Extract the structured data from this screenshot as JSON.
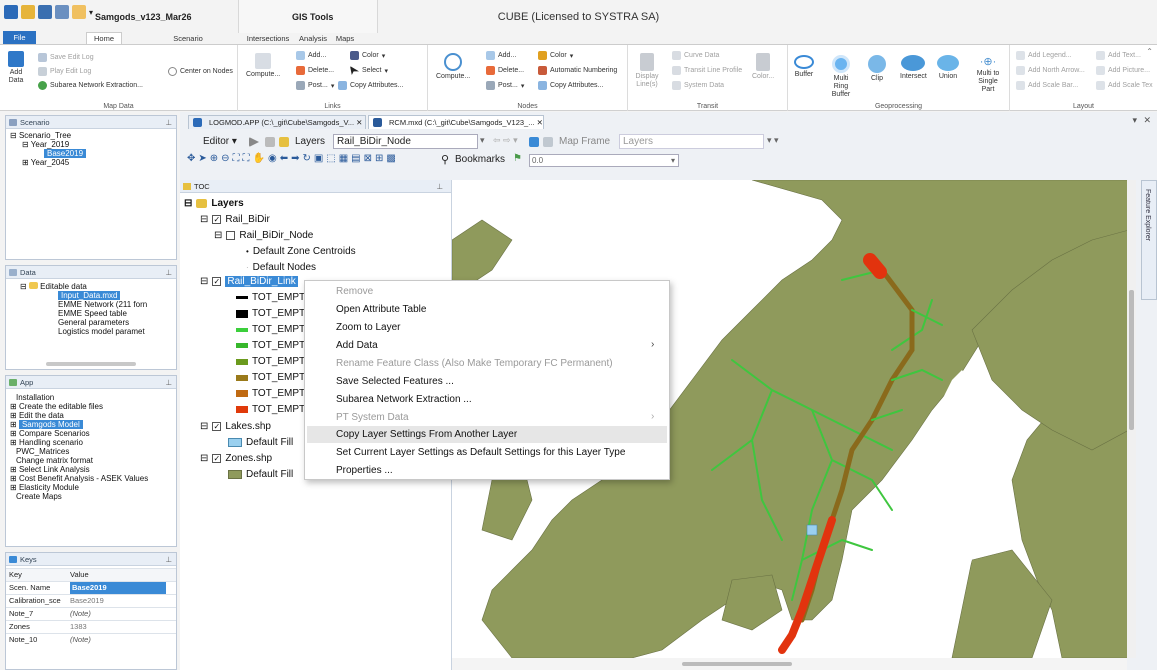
{
  "window": {
    "app_title": "CUBE (Licensed to SYSTRA SA)",
    "doc_title": "Samgods_v123_Mar26",
    "context_title": "GIS Tools"
  },
  "tabs": {
    "file": "File",
    "home": "Home",
    "scenario": "Scenario",
    "intersections": "Intersections",
    "analysis": "Analysis",
    "maps": "Maps"
  },
  "ribbon": {
    "map_data": {
      "label": "Map Data",
      "add_data": "Add Data",
      "save_edit_log": "Save Edit Log",
      "play_edit_log": "Play Edit Log",
      "subarea_extraction": "Subarea Network Extraction...",
      "center_on_nodes": "Center on Nodes"
    },
    "links": {
      "label": "Links",
      "compute": "Compute...",
      "add": "Add...",
      "delete": "Delete...",
      "post": "Post...",
      "color": "Color",
      "select": "Select",
      "copy_attributes": "Copy Attributes..."
    },
    "nodes": {
      "label": "Nodes",
      "compute": "Compute...",
      "add": "Add...",
      "delete": "Delete...",
      "post": "Post...",
      "color": "Color",
      "automatic_numbering": "Automatic Numbering",
      "copy_attributes": "Copy Attributes..."
    },
    "transit": {
      "label": "Transit",
      "display_lines": "Display Line(s)",
      "curve_data": "Curve Data",
      "transit_line_profile": "Transit Line Profile",
      "system_data": "System Data",
      "color": "Color..."
    },
    "geoprocessing": {
      "label": "Geoprocessing",
      "buffer": "Buffer",
      "multi_ring_buffer": "Multi Ring Buffer",
      "clip": "Clip",
      "intersect": "Intersect",
      "union": "Union",
      "multi_to_single": "Multi to Single Part"
    },
    "layout": {
      "label": "Layout",
      "add_legend": "Add Legend...",
      "add_north_arrow": "Add North Arrow...",
      "add_scale_bar": "Add Scale Bar...",
      "add_text": "Add Text...",
      "add_picture": "Add Picture...",
      "add_scale_text": "Add Scale Tex"
    }
  },
  "scenario_pane": {
    "title": "Scenario",
    "items": [
      "Scenario_Tree",
      "Year_2019",
      "Base2019",
      "Year_2045"
    ]
  },
  "data_pane": {
    "title": "Data",
    "items": [
      "Editable data",
      "Input_Data.mxd",
      "EMME Network (211 forn",
      "EMME Speed table",
      "General parameters",
      "Logistics model paramet"
    ]
  },
  "app_pane": {
    "title": "App",
    "items": [
      "Installation",
      "Create the editable files",
      "Edit the data",
      "Samgods Model",
      "Compare Scenarios",
      "Handling scenario",
      "PWC_Matrices",
      "Change matrix format",
      "Select Link Analysis",
      "Cost Benefit Analysis - ASEK Values",
      "Elasticity Module",
      "Create Maps"
    ]
  },
  "keys_pane": {
    "title": "Keys",
    "col_key": "Key",
    "col_value": "Value",
    "rows": [
      {
        "key": "Scen. Name",
        "value": "Base2019"
      },
      {
        "key": "Calibration_sce",
        "value": "Base2019"
      },
      {
        "key": "Note_7",
        "value": "(Note)"
      },
      {
        "key": "Zones",
        "value": "1383"
      },
      {
        "key": "Note_10",
        "value": "(Note)"
      }
    ]
  },
  "doc_tabs": {
    "tab1": "LOGMOD.APP (C:\\_git\\Cube\\Samgods_V...",
    "tab2": "RCM.mxd (C:\\_git\\Cube\\Samgods_V123_..."
  },
  "toolbar": {
    "editor": "Editor",
    "layers_label": "Layers",
    "layers_value": "Rail_BiDir_Node",
    "map_frame_label": "Map Frame",
    "map_frame_value": "Layers",
    "bookmarks": "Bookmarks",
    "zoom_value": "0.0"
  },
  "toc": {
    "title": "TOC",
    "layers": "Layers",
    "rail_bidir": "Rail_BiDir",
    "rail_bidir_node": "Rail_BiDir_Node",
    "default_zone_centroids": "Default Zone Centroids",
    "default_nodes": "Default Nodes",
    "rail_bidir_link": "Rail_BiDir_Link",
    "tot_empt": "TOT_EMPT",
    "lakes": "Lakes.shp",
    "zones": "Zones.shp",
    "default_fill": "Default Fill",
    "legend_colors": [
      "#000000",
      "#000000",
      "#3ccf3c",
      "#37b82c",
      "#6b9a1d",
      "#9a7a1a",
      "#c06a12",
      "#e03a0a"
    ]
  },
  "context_menu": {
    "items": [
      {
        "label": "Remove",
        "disabled": true
      },
      {
        "label": "Open Attribute Table",
        "disabled": false
      },
      {
        "label": "Zoom to Layer",
        "disabled": false
      },
      {
        "label": "Add Data",
        "disabled": false
      },
      {
        "label": "Rename Feature Class (Also Make Temporary FC Permanent)",
        "disabled": true
      },
      {
        "label": "Save Selected Features ...",
        "disabled": false
      },
      {
        "label": "Subarea Network Extraction ...",
        "disabled": false
      },
      {
        "label": "PT System Data",
        "disabled": true
      },
      {
        "label": "Copy Layer Settings From Another Layer",
        "disabled": false
      },
      {
        "label": "Set Current Layer Settings as Default Settings for this Layer Type",
        "disabled": false
      },
      {
        "label": "Properties ...",
        "disabled": false
      }
    ]
  },
  "feature_explorer": "Feature Explorer",
  "colors": {
    "land": "#8f9a5c",
    "water": "#ffffff",
    "rail_green": "#3fc63f",
    "rail_brown": "#8a6a1c",
    "rail_red": "#e2330e",
    "selection": "#3a8ad6"
  }
}
